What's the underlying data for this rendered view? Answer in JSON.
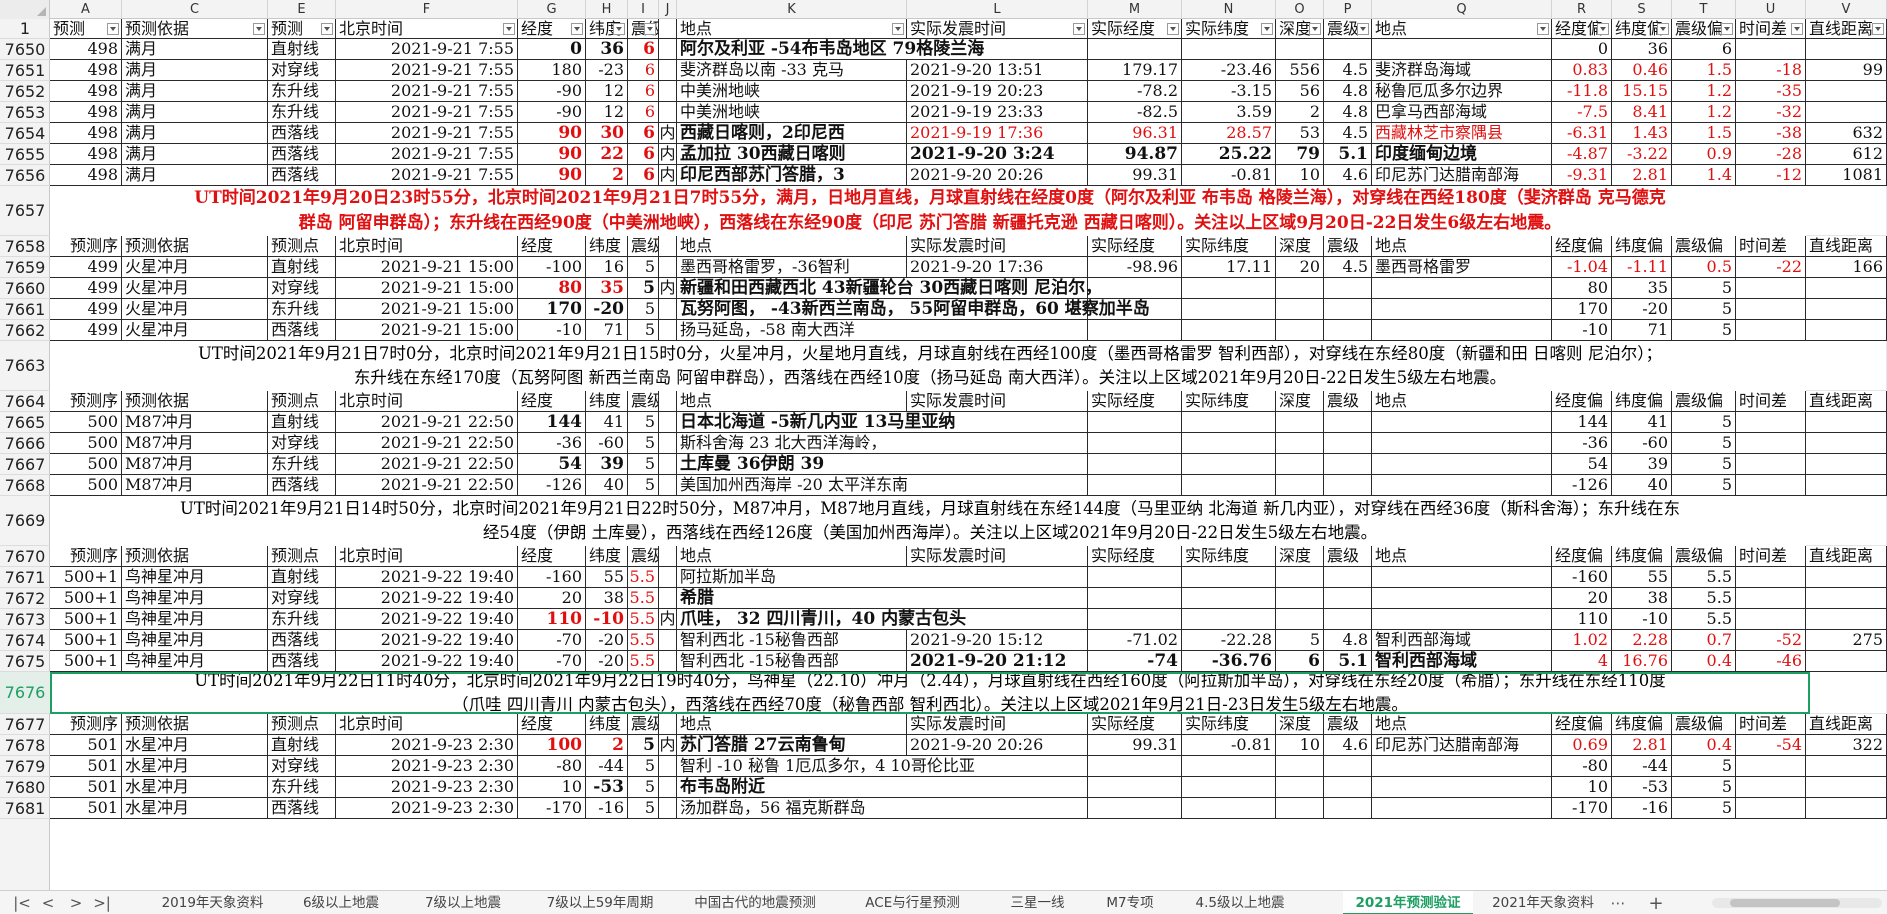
{
  "columns": [
    " ",
    "A",
    "C",
    "E",
    "F",
    "G",
    "H",
    "I",
    "J",
    "K",
    "L",
    "M",
    "N",
    "O",
    "P",
    "Q",
    "R",
    "S",
    "T",
    "U",
    "V"
  ],
  "tabs": [
    "2019年天象资料",
    "6级以上地震",
    "7级以上地震",
    "7级以上59年周期",
    "中国古代的地震预测",
    "ACE与行星预测",
    "三星一线",
    "M7专项",
    "4.5级以上地震",
    "2021年预测验证",
    "2021年天象资料"
  ],
  "header_row": {
    "num": "1",
    "cells": [
      "预测",
      "预测依据",
      "预测",
      "北京时间",
      "经度",
      "纬度",
      "震级",
      "",
      "地点",
      "实际发震时间",
      "实际经度",
      "实际纬度",
      "深度",
      "震级",
      "地点",
      "经度偏",
      "纬度偏",
      "震级偏",
      "时间差",
      "直线距离"
    ]
  },
  "sub_header": [
    "预测序",
    "预测依据",
    "预测点",
    "北京时间",
    "经度",
    "纬度",
    "震级",
    "",
    "地点",
    "实际发震时间",
    "实际经度",
    "实际纬度",
    "深度",
    "震级",
    "地点",
    "经度偏",
    "纬度偏",
    "震级偏",
    "时间差",
    "直线距离"
  ],
  "rows": [
    {
      "n": "7650",
      "cells": [
        "498",
        "满月",
        "直射线",
        "2021-9-21 7:55",
        "0",
        "36",
        "6",
        "",
        "阿尔及利亚 -54布韦岛地区 79格陵兰海",
        "",
        "",
        "",
        "",
        "",
        "",
        "0",
        "36",
        "6",
        "",
        ""
      ]
    },
    {
      "n": "7651",
      "cells": [
        "498",
        "满月",
        "对穿线",
        "2021-9-21 7:55",
        "180",
        "-23",
        "6",
        "",
        "斐济群岛以南 -33 克马",
        "2021-9-20 13:51",
        "179.17",
        "-23.46",
        "556",
        "4.5",
        "斐济群岛海域",
        "0.83",
        "0.46",
        "1.5",
        "-18",
        "99"
      ]
    },
    {
      "n": "7652",
      "cells": [
        "498",
        "满月",
        "东升线",
        "2021-9-21 7:55",
        "-90",
        "12",
        "6",
        "",
        "中美洲地峡",
        "2021-9-19 20:23",
        "-78.2",
        "-3.15",
        "56",
        "4.8",
        "秘鲁厄瓜多尔边界",
        "-11.8",
        "15.15",
        "1.2",
        "-35",
        ""
      ]
    },
    {
      "n": "7653",
      "cells": [
        "498",
        "满月",
        "东升线",
        "2021-9-21 7:55",
        "-90",
        "12",
        "6",
        "",
        "中美洲地峡",
        "2021-9-19 23:33",
        "-82.5",
        "3.59",
        "2",
        "4.8",
        "巴拿马西部海域",
        "-7.5",
        "8.41",
        "1.2",
        "-32",
        ""
      ]
    },
    {
      "n": "7654",
      "cells": [
        "498",
        "满月",
        "西落线",
        "2021-9-21 7:55",
        "90",
        "30",
        "6",
        "内",
        "西藏日喀则，2印尼西",
        "2021-9-19 17:36",
        "96.31",
        "28.57",
        "53",
        "4.5",
        "西藏林芝市察隅县",
        "-6.31",
        "1.43",
        "1.5",
        "-38",
        "632"
      ]
    },
    {
      "n": "7655",
      "cells": [
        "498",
        "满月",
        "西落线",
        "2021-9-21 7:55",
        "90",
        "22",
        "6",
        "内",
        "孟加拉 30西藏日喀则",
        "2021-9-20 3:24",
        "94.87",
        "25.22",
        "79",
        "5.1",
        "印度缅甸边境",
        "-4.87",
        "-3.22",
        "0.9",
        "-28",
        "612"
      ]
    },
    {
      "n": "7656",
      "cells": [
        "498",
        "满月",
        "西落线",
        "2021-9-21 7:55",
        "90",
        "2",
        "6",
        "内",
        "印尼西部苏门答腊，3",
        "2021-9-20 20:26",
        "99.31",
        "-0.81",
        "10",
        "4.6",
        "印尼苏门达腊南部海",
        "-9.31",
        "2.81",
        "1.4",
        "-12",
        "1081"
      ]
    },
    {
      "n": "7658",
      "cells": [
        "预测序",
        "预测依据",
        "预测点",
        "北京时间",
        "经度",
        "纬度",
        "震级",
        "",
        "地点",
        "实际发震时间",
        "实际经度",
        "实际纬度",
        "深度",
        "震级",
        "地点",
        "经度偏",
        "纬度偏",
        "震级偏",
        "时间差",
        "直线距离"
      ]
    },
    {
      "n": "7659",
      "cells": [
        "499",
        "火星冲月",
        "直射线",
        "2021-9-21 15:00",
        "-100",
        "16",
        "5",
        "",
        "墨西哥格雷罗，-36智利",
        "2021-9-20 17:36",
        "-98.96",
        "17.11",
        "20",
        "4.5",
        "墨西哥格雷罗",
        "-1.04",
        "-1.11",
        "0.5",
        "-22",
        "166"
      ]
    },
    {
      "n": "7660",
      "cells": [
        "499",
        "火星冲月",
        "对穿线",
        "2021-9-21 15:00",
        "80",
        "35",
        "5",
        "内",
        "新疆和田西藏西北 43新疆轮台 30西藏日喀则 尼泊尔，",
        "",
        "",
        "",
        "",
        "",
        "",
        "80",
        "35",
        "5",
        "",
        ""
      ]
    },
    {
      "n": "7661",
      "cells": [
        "499",
        "火星冲月",
        "东升线",
        "2021-9-21 15:00",
        "170",
        "-20",
        "5",
        "",
        "瓦努阿图， -43新西兰南岛， 55阿留申群岛，60 堪察加半岛",
        "",
        "",
        "",
        "",
        "",
        "",
        "170",
        "-20",
        "5",
        "",
        ""
      ]
    },
    {
      "n": "7662",
      "cells": [
        "499",
        "火星冲月",
        "西落线",
        "2021-9-21 15:00",
        "-10",
        "71",
        "5",
        "",
        "扬马延岛，-58 南大西洋",
        "",
        "",
        "",
        "",
        "",
        "",
        "-10",
        "71",
        "5",
        "",
        ""
      ]
    },
    {
      "n": "7664",
      "cells": [
        "预测序",
        "预测依据",
        "预测点",
        "北京时间",
        "经度",
        "纬度",
        "震级",
        "",
        "地点",
        "实际发震时间",
        "实际经度",
        "实际纬度",
        "深度",
        "震级",
        "地点",
        "经度偏",
        "纬度偏",
        "震级偏",
        "时间差",
        "直线距离"
      ]
    },
    {
      "n": "7665",
      "cells": [
        "500",
        "M87冲月",
        "直射线",
        "2021-9-21 22:50",
        "144",
        "41",
        "5",
        "",
        "日本北海道 -5新几内亚 13马里亚纳",
        "",
        "",
        "",
        "",
        "",
        "",
        "144",
        "41",
        "5",
        "",
        ""
      ]
    },
    {
      "n": "7666",
      "cells": [
        "500",
        "M87冲月",
        "对穿线",
        "2021-9-21 22:50",
        "-36",
        "-60",
        "5",
        "",
        "斯科舍海 23 北大西洋海岭，",
        "",
        "",
        "",
        "",
        "",
        "",
        "-36",
        "-60",
        "5",
        "",
        ""
      ]
    },
    {
      "n": "7667",
      "cells": [
        "500",
        "M87冲月",
        "东升线",
        "2021-9-21 22:50",
        "54",
        "39",
        "5",
        "",
        "土库曼 36伊朗 39",
        "",
        "",
        "",
        "",
        "",
        "",
        "54",
        "39",
        "5",
        "",
        ""
      ]
    },
    {
      "n": "7668",
      "cells": [
        "500",
        "M87冲月",
        "西落线",
        "2021-9-21 22:50",
        "-126",
        "40",
        "5",
        "",
        "美国加州西海岸 -20 太平洋东南",
        "",
        "",
        "",
        "",
        "",
        "",
        "-126",
        "40",
        "5",
        "",
        ""
      ]
    },
    {
      "n": "7670",
      "cells": [
        "预测序",
        "预测依据",
        "预测点",
        "北京时间",
        "经度",
        "纬度",
        "震级",
        "",
        "地点",
        "实际发震时间",
        "实际经度",
        "实际纬度",
        "深度",
        "震级",
        "地点",
        "经度偏",
        "纬度偏",
        "震级偏",
        "时间差",
        "直线距离"
      ]
    },
    {
      "n": "7671",
      "cells": [
        "500+1",
        "鸟神星冲月",
        "直射线",
        "2021-9-22 19:40",
        "-160",
        "55",
        "5.5",
        "",
        "阿拉斯加半岛",
        "",
        "",
        "",
        "",
        "",
        "",
        "-160",
        "55",
        "5.5",
        "",
        ""
      ]
    },
    {
      "n": "7672",
      "cells": [
        "500+1",
        "鸟神星冲月",
        "对穿线",
        "2021-9-22 19:40",
        "20",
        "38",
        "5.5",
        "",
        "希腊",
        "",
        "",
        "",
        "",
        "",
        "",
        "20",
        "38",
        "5.5",
        "",
        ""
      ]
    },
    {
      "n": "7673",
      "cells": [
        "500+1",
        "鸟神星冲月",
        "东升线",
        "2021-9-22 19:40",
        "110",
        "-10",
        "5.5",
        "内",
        "爪哇， 32 四川青川，40 内蒙古包头",
        "",
        "",
        "",
        "",
        "",
        "",
        "110",
        "-10",
        "5.5",
        "",
        ""
      ]
    },
    {
      "n": "7674",
      "cells": [
        "500+1",
        "鸟神星冲月",
        "西落线",
        "2021-9-22 19:40",
        "-70",
        "-20",
        "5.5",
        "",
        "智利西北 -15秘鲁西部",
        "2021-9-20 15:12",
        "-71.02",
        "-22.28",
        "5",
        "4.8",
        "智利西部海域",
        "1.02",
        "2.28",
        "0.7",
        "-52",
        "275"
      ]
    },
    {
      "n": "7675",
      "cells": [
        "500+1",
        "鸟神星冲月",
        "西落线",
        "2021-9-22 19:40",
        "-70",
        "-20",
        "5.5",
        "",
        "智利西北 -15秘鲁西部",
        "2021-9-20 21:12",
        "-74",
        "-36.76",
        "6",
        "5.1",
        "智利西部海域",
        "4",
        "16.76",
        "0.4",
        "-46",
        ""
      ]
    },
    {
      "n": "7677",
      "cells": [
        "预测序",
        "预测依据",
        "预测点",
        "北京时间",
        "经度",
        "纬度",
        "震级",
        "",
        "地点",
        "实际发震时间",
        "实际经度",
        "实际纬度",
        "深度",
        "震级",
        "地点",
        "经度偏",
        "纬度偏",
        "震级偏",
        "时间差",
        "直线距离"
      ]
    },
    {
      "n": "7678",
      "cells": [
        "501",
        "水星冲月",
        "直射线",
        "2021-9-23 2:30",
        "100",
        "2",
        "5",
        "内",
        "苏门答腊 27云南鲁甸",
        "2021-9-20 20:26",
        "99.31",
        "-0.81",
        "10",
        "4.6",
        "印尼苏门达腊南部海",
        "0.69",
        "2.81",
        "0.4",
        "-54",
        "322"
      ]
    },
    {
      "n": "7679",
      "cells": [
        "501",
        "水星冲月",
        "对穿线",
        "2021-9-23 2:30",
        "-80",
        "-44",
        "5",
        "",
        "智利 -10 秘鲁 1厄瓜多尔，4 10哥伦比亚",
        "",
        "",
        "",
        "",
        "",
        "",
        "-80",
        "-44",
        "5",
        "",
        ""
      ]
    },
    {
      "n": "7680",
      "cells": [
        "501",
        "水星冲月",
        "东升线",
        "2021-9-23 2:30",
        "10",
        "-53",
        "5",
        "",
        "布韦岛附近",
        "",
        "",
        "",
        "",
        "",
        "",
        "10",
        "-53",
        "5",
        "",
        ""
      ]
    },
    {
      "n": "7681",
      "cells": [
        "501",
        "水星冲月",
        "西落线",
        "2021-9-23 2:30",
        "-170",
        "-16",
        "5",
        "",
        "汤加群岛，56 福克斯群岛",
        "",
        "",
        "",
        "",
        "",
        "",
        "-170",
        "-16",
        "5",
        "",
        ""
      ]
    }
  ],
  "notes": {
    "7657": [
      "UT时间2021年9月20日23时55分，北京时间2021年9月21日7时55分，满月，日地月直线，月球直射线在经度0度（阿尔及利亚 布韦岛 格陵兰海），对穿线在西经180度（斐济群岛 克马德克",
      "群岛 阿留申群岛）；东升线在西经90度（中美洲地峡），西落线在东经90度（印尼 苏门答腊 新疆托克逊 西藏日喀则）。关注以上区域9月20日-22日发生6级左右地震。"
    ],
    "7663": [
      "UT时间2021年9月21日7时0分，北京时间2021年9月21日15时0分，火星冲月，火星地月直线，月球直射线在西经100度（墨西哥格雷罗 智利西部），对穿线在东经80度（新疆和田 日喀则 尼泊尔）；",
      "东升线在东经170度（瓦努阿图 新西兰南岛 阿留申群岛），西落线在西经10度（扬马延岛 南大西洋）。关注以上区域2021年9月20日-22日发生5级左右地震。"
    ],
    "7669": [
      "UT时间2021年9月21日14时50分，北京时间2021年9月21日22时50分，M87冲月，M87地月直线，月球直射线在东经144度（马里亚纳 北海道 新几内亚），对穿线在西经36度（斯科舍海）；东升线在东",
      "经54度（伊朗 土库曼），西落线在西经126度（美国加州西海岸）。关注以上区域2021年9月20日-22日发生5级左右地震。"
    ],
    "7676": [
      "UT时间2021年9月22日11时40分，北京时间2021年9月22日19时40分，鸟神星（22.10）冲月（2.44），月球直射线在西经160度（阿拉斯加半岛），对穿线在东经20度（希腊）；东升线在东经110度",
      "（爪哇 四川青川 内蒙古包头），西落线在西经70度（秘鲁西部 智利西北）。关注以上区域2021年9月21日-23日发生5级左右地震。"
    ]
  },
  "selected_row": "7676"
}
